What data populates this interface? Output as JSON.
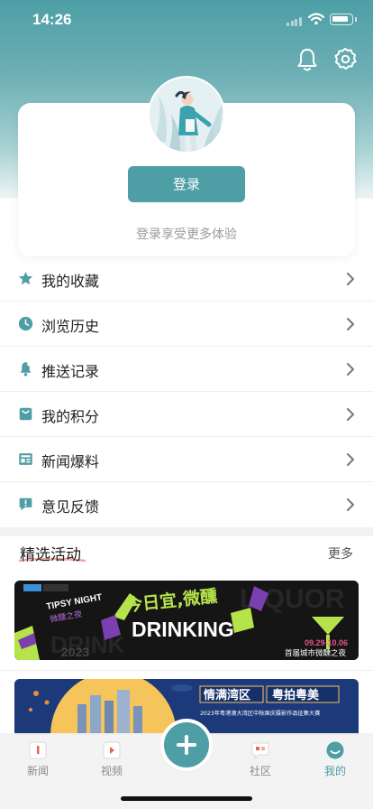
{
  "status_bar": {
    "time": "14:26"
  },
  "header": {
    "bell_icon": "bell-icon",
    "settings_icon": "gear-icon"
  },
  "login_card": {
    "button_label": "登录",
    "hint": "登录享受更多体验"
  },
  "menu": {
    "items": [
      {
        "label": "我的收藏",
        "icon": "star-icon"
      },
      {
        "label": "浏览历史",
        "icon": "clock-icon"
      },
      {
        "label": "推送记录",
        "icon": "bell-icon"
      },
      {
        "label": "我的积分",
        "icon": "bag-icon"
      },
      {
        "label": "新闻爆料",
        "icon": "newspaper-icon"
      },
      {
        "label": "意见反馈",
        "icon": "feedback-icon"
      }
    ]
  },
  "featured": {
    "title": "精选活动",
    "more": "更多",
    "banners": [
      {
        "headline_cn": "今日宜,微醺",
        "headline_en": "DRINKING",
        "dates": "09.29-10.06",
        "subtitle": "首届城市微醺之夜",
        "year": "2023",
        "corner_tag": "TIPSY NIGHT",
        "corner_cn": "微醺之夜"
      },
      {
        "slogan_left": "情满湾区",
        "slogan_right": "粤拍粤美",
        "caption": "2023年粤港澳大湾区中秋国庆摄影作品征集大赛"
      }
    ]
  },
  "tabbar": {
    "tabs": [
      {
        "label": "新闻",
        "active": false
      },
      {
        "label": "视频",
        "active": false
      },
      {
        "label": "社区",
        "active": false
      },
      {
        "label": "我的",
        "active": true
      }
    ],
    "fab_icon": "plus-icon"
  },
  "colors": {
    "accent": "#4e9ea5",
    "text": "#222222",
    "muted": "#9a9a9a",
    "banner_green": "#b6e34a"
  }
}
